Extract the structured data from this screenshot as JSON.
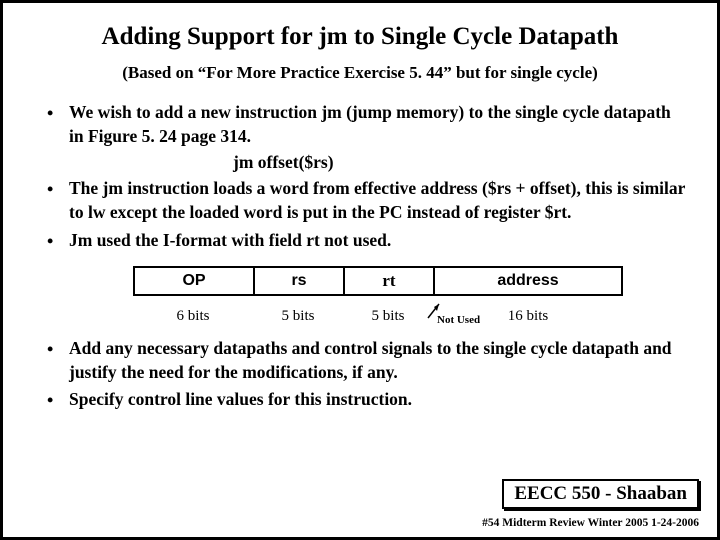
{
  "title": "Adding Support for jm to Single Cycle Datapath",
  "subtitle": "(Based on “For More Practice Exercise 5. 44” but for single cycle)",
  "bullets": {
    "b1": "We wish to add  a new instruction jm (jump memory)  to the single cycle datapath in Figure 5. 24 page 314.",
    "b2": "The jm instruction loads a word from effective address ($rs + offset), this is similar to lw except the loaded word is put in the PC instead of register $rt.",
    "b3": "Jm used the I-format with field  rt not used.",
    "b4": "Add any necessary datapaths and control signals to the single cycle datapath and justify the need for the modifications, if any.",
    "b5": "Specify control line values for this instruction."
  },
  "code": "jm   offset($rs)",
  "format": {
    "headers": {
      "op": "OP",
      "rs": "rs",
      "rt": "rt",
      "addr": "address"
    },
    "bits": {
      "op": "6 bits",
      "rs": "5 bits",
      "rt": "5 bits",
      "addr": "16  bits"
    },
    "notused": "Not Used"
  },
  "footer": {
    "course": "EECC 550 -  Shaaban",
    "meta": "#54  Midterm Review  Winter 2005  1-24-2006"
  }
}
